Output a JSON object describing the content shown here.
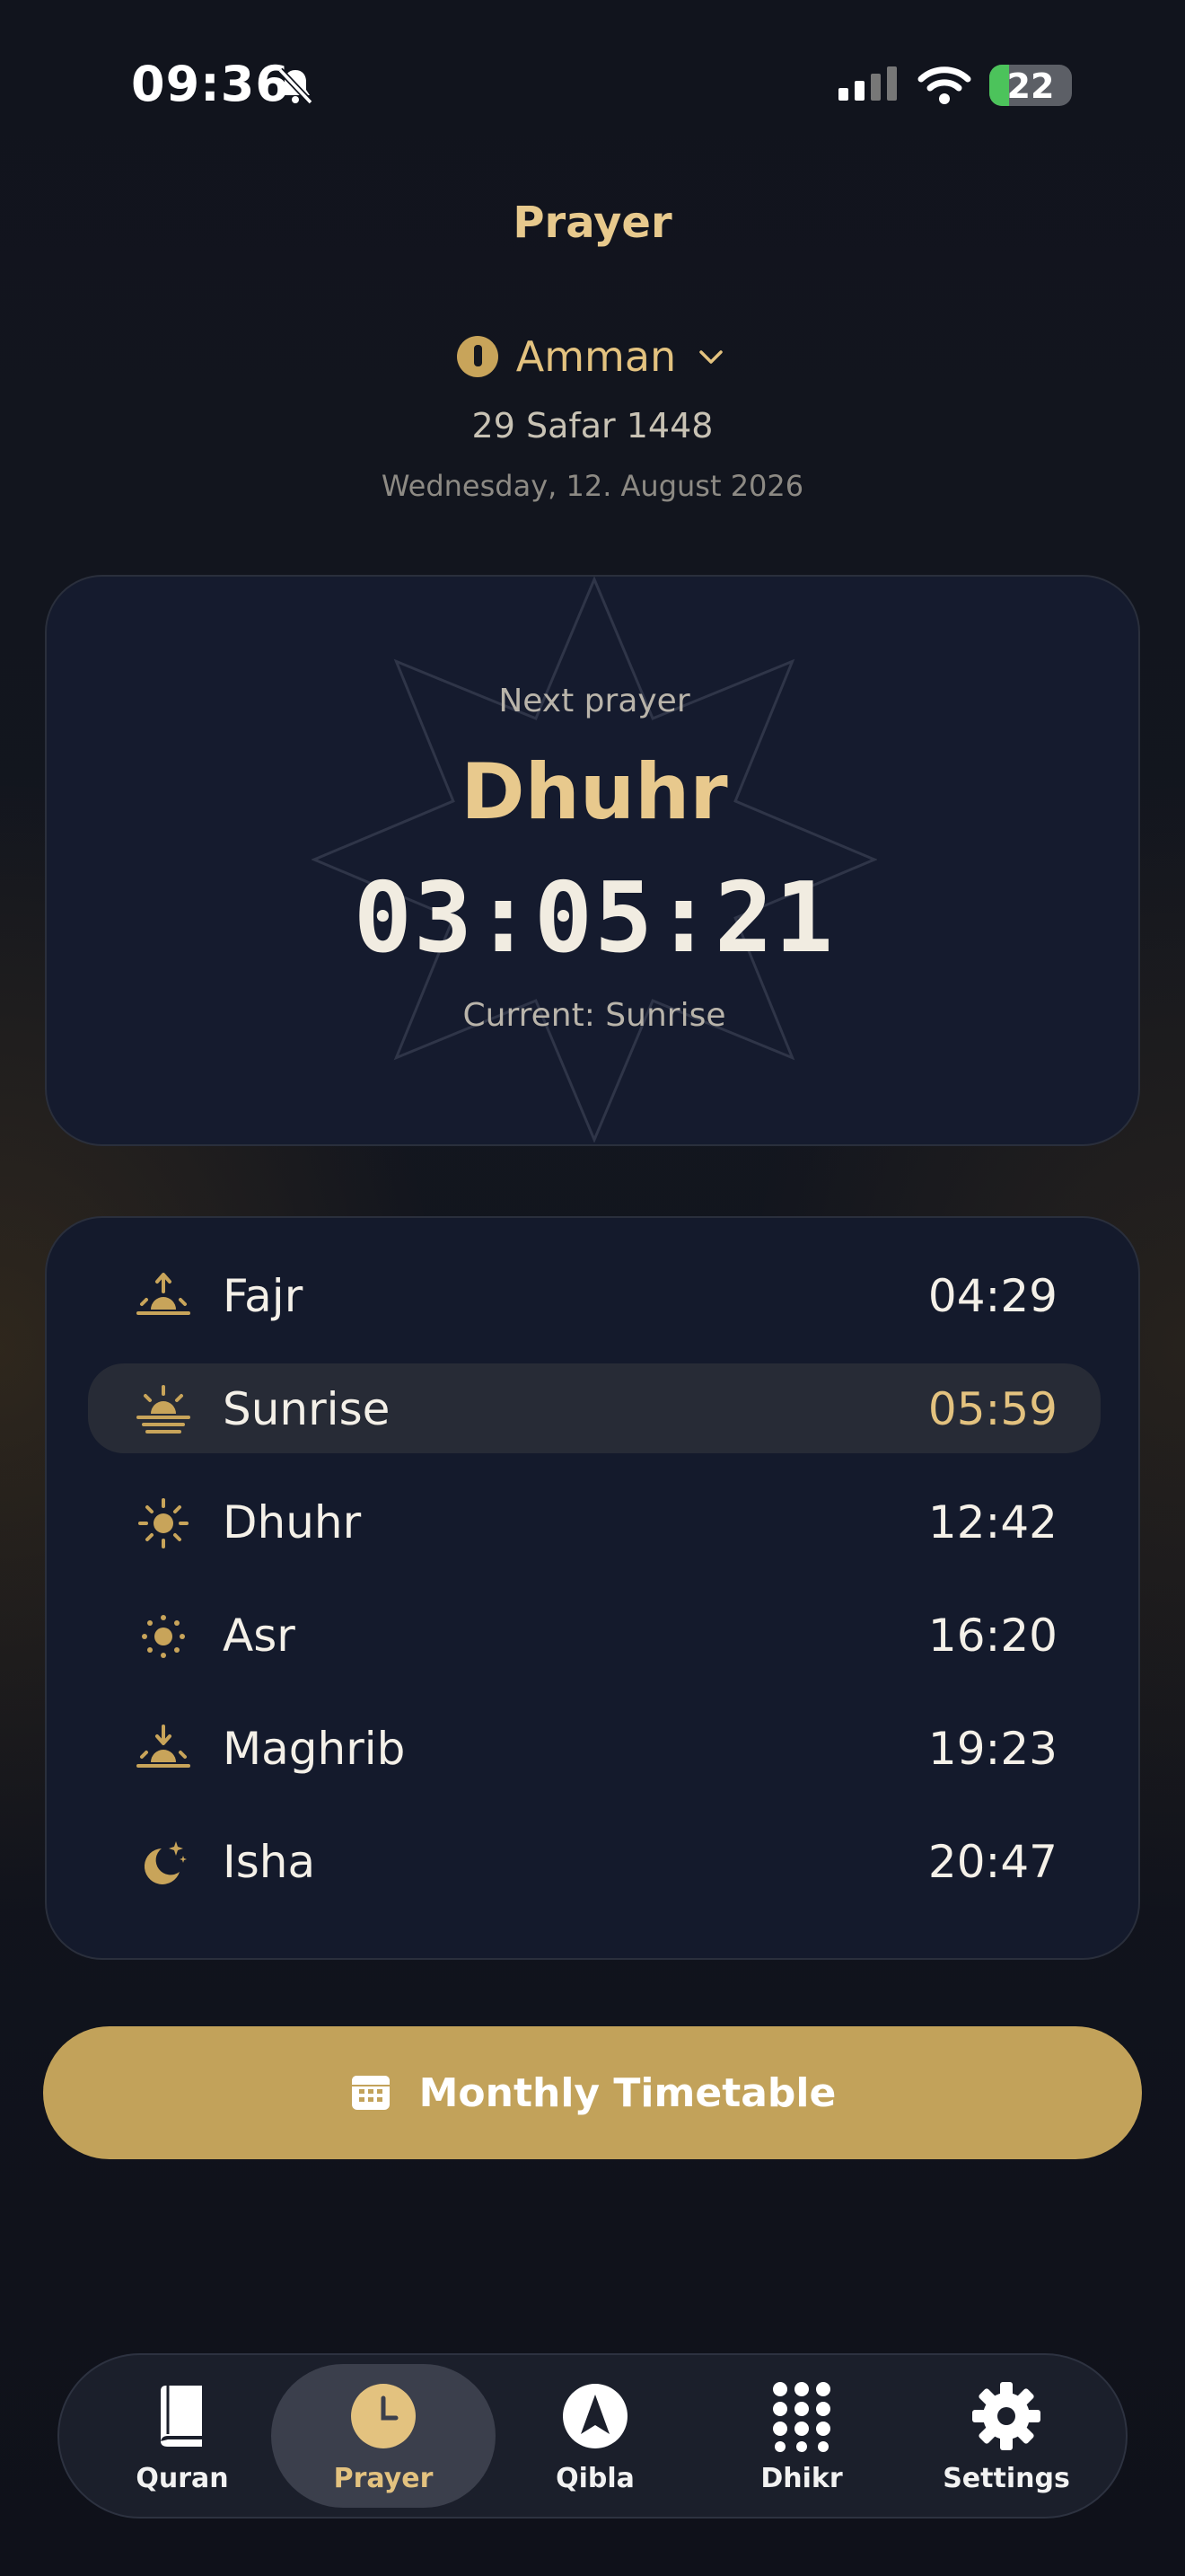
{
  "status_bar": {
    "time": "09:36",
    "battery": "22"
  },
  "header": {
    "title": "Prayer",
    "location": "Amman",
    "hijri_date": "29 Safar 1448",
    "gregorian_date": "Wednesday, 12. August 2026"
  },
  "next_prayer": {
    "label": "Next prayer",
    "name": "Dhuhr",
    "countdown": "03:05:21",
    "current": "Current: Sunrise"
  },
  "prayers": [
    {
      "name": "Fajr",
      "time": "04:29",
      "icon": "sunrise-arrow-icon",
      "active": false
    },
    {
      "name": "Sunrise",
      "time": "05:59",
      "icon": "sun-horizon-icon",
      "active": true
    },
    {
      "name": "Dhuhr",
      "time": "12:42",
      "icon": "sun-icon",
      "active": false
    },
    {
      "name": "Asr",
      "time": "16:20",
      "icon": "sun-small-icon",
      "active": false
    },
    {
      "name": "Maghrib",
      "time": "19:23",
      "icon": "sunset-arrow-icon",
      "active": false
    },
    {
      "name": "Isha",
      "time": "20:47",
      "icon": "moon-stars-icon",
      "active": false
    }
  ],
  "actions": {
    "monthly_timetable": "Monthly Timetable"
  },
  "tabs": [
    {
      "label": "Quran",
      "icon": "book-icon",
      "active": false
    },
    {
      "label": "Prayer",
      "icon": "clock-icon",
      "active": true
    },
    {
      "label": "Qibla",
      "icon": "compass-arrow-icon",
      "active": false
    },
    {
      "label": "Dhikr",
      "icon": "dots-grid-icon",
      "active": false
    },
    {
      "label": "Settings",
      "icon": "gear-icon",
      "active": false
    }
  ],
  "colors": {
    "accent": "#e3c27f",
    "button": "#c2a25a",
    "card": "#151b2e",
    "background": "#11141d"
  }
}
